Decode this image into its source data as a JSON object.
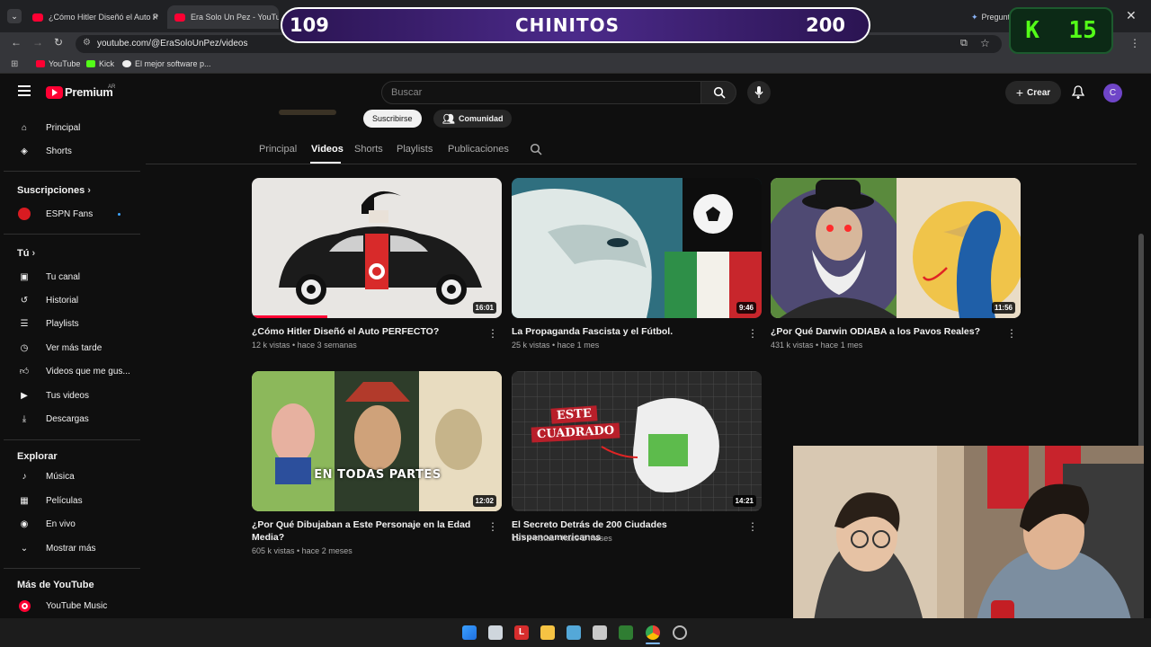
{
  "browser": {
    "tabs": [
      {
        "label": "¿Cómo Hitler Diseñó el Auto P"
      },
      {
        "label": "Era Solo Un Pez - YouTube"
      },
      {
        "label": "Pregunt"
      }
    ],
    "url": "youtube.com/@EraSoloUnPez/videos",
    "bookmarks": [
      "YouTube",
      "Kick",
      "El mejor software p..."
    ]
  },
  "stream_overlay": {
    "left_count": "109",
    "title": "CHINITOS",
    "right_count": "200",
    "kick_letter": "K",
    "kick_count": "15"
  },
  "yt_header": {
    "logo_text": "Premium",
    "region": "AR",
    "search_placeholder": "Buscar",
    "create_label": "Crear",
    "avatar_letter": "C"
  },
  "sidebar": {
    "main": [
      {
        "label": "Principal",
        "icon": "home-icon"
      },
      {
        "label": "Shorts",
        "icon": "shorts-icon"
      }
    ],
    "subscriptions_title": "Suscripciones",
    "subscriptions": [
      {
        "label": "ESPN Fans"
      }
    ],
    "you_title": "Tú",
    "you": [
      {
        "label": "Tu canal",
        "icon": "channel-icon"
      },
      {
        "label": "Historial",
        "icon": "history-icon"
      },
      {
        "label": "Playlists",
        "icon": "playlists-icon"
      },
      {
        "label": "Ver más tarde",
        "icon": "watch-later-icon"
      },
      {
        "label": "Videos que me gus...",
        "icon": "liked-icon"
      },
      {
        "label": "Tus videos",
        "icon": "your-videos-icon"
      },
      {
        "label": "Descargas",
        "icon": "downloads-icon"
      }
    ],
    "explore_title": "Explorar",
    "explore": [
      {
        "label": "Música",
        "icon": "music-icon"
      },
      {
        "label": "Películas",
        "icon": "movies-icon"
      },
      {
        "label": "En vivo",
        "icon": "live-icon"
      },
      {
        "label": "Mostrar más",
        "icon": "chevron-down-icon"
      }
    ],
    "more_title": "Más de YouTube",
    "more": [
      {
        "label": "YouTube Music",
        "icon": "youtube-music-icon"
      }
    ]
  },
  "channel": {
    "subscribe_label": "Suscribirse",
    "community_label": "Comunidad",
    "tabs": [
      "Principal",
      "Videos",
      "Shorts",
      "Playlists",
      "Publicaciones"
    ],
    "active_tab": "Videos"
  },
  "videos": [
    {
      "title": "¿Cómo Hitler Diseñó el Auto PERFECTO?",
      "meta": "12 k vistas • hace 3 semanas",
      "duration": "16:01"
    },
    {
      "title": "La Propaganda Fascista y el Fútbol.",
      "meta": "25 k vistas • hace 1 mes",
      "duration": "9:46"
    },
    {
      "title": "¿Por Qué Darwin ODIABA a los Pavos Reales?",
      "meta": "431 k vistas • hace 1 mes",
      "duration": "11:56"
    },
    {
      "title": "¿Por Qué Dibujaban a Este Personaje en la Edad Media?",
      "meta": "605 k vistas • hace 2 meses",
      "duration": "12:02",
      "thumb_text": "EN TODAS PARTES"
    },
    {
      "title": "El Secreto Detrás de 200 Ciudades Hispanoamericanas",
      "meta": "127 k vistas • hace 2 meses",
      "duration": "14:21",
      "thumb_text_1": "ESTE",
      "thumb_text_2": "CUADRADO"
    }
  ],
  "colors": {
    "accent": "#ff0033",
    "kick_green": "#53fc18",
    "overlay_purple": "#4b2a8a"
  }
}
